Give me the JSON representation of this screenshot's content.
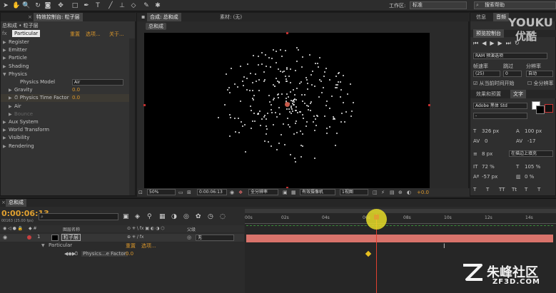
{
  "app": {
    "workspace_label": "工作区:",
    "workspace_value": "标准",
    "search_placeholder": "搜索帮助"
  },
  "left_panel": {
    "tab_close": "×",
    "tab_label": "特效控制台: 粒子层",
    "breadcrumb": "总和成 • 粒子层",
    "effect_name": "Particular",
    "reset_label": "重置",
    "options_label": "选项...",
    "about_label": "关于...",
    "properties": [
      {
        "label": "Register",
        "indent": 0,
        "value": ""
      },
      {
        "label": "Emitter",
        "indent": 0,
        "value": ""
      },
      {
        "label": "Particle",
        "indent": 0,
        "value": ""
      },
      {
        "label": "Shading",
        "indent": 0,
        "value": ""
      },
      {
        "label": "Physics",
        "indent": 0,
        "value": "",
        "open": true
      },
      {
        "label": "Physics Model",
        "indent": 2,
        "value": "Air",
        "dropdown": true
      },
      {
        "label": "Gravity",
        "indent": 1,
        "value": "0.0"
      },
      {
        "label": "Physics Time Factor",
        "indent": 1,
        "value": "0.0",
        "stopwatch": true
      },
      {
        "label": "Air",
        "indent": 1,
        "value": ""
      },
      {
        "label": "Bounce",
        "indent": 1,
        "value": "",
        "disabled": true
      },
      {
        "label": "Aux System",
        "indent": 0,
        "value": ""
      },
      {
        "label": "World Transform",
        "indent": 0,
        "value": ""
      },
      {
        "label": "Visibility",
        "indent": 0,
        "value": ""
      },
      {
        "label": "Rendering",
        "indent": 0,
        "value": ""
      }
    ]
  },
  "viewer": {
    "tab_label": "合成: 总和成",
    "footage_tab": "素材: (无)",
    "comp_chip": "总和成",
    "zoom": "50%",
    "timecode": "0:00:06:13",
    "resolution": "全分辨率",
    "camera": "有效摄像机",
    "view": "1视图",
    "exposure": "+0.0"
  },
  "right_panel": {
    "tab_info": "信息",
    "tab_audio": "音频",
    "preview_title": "预览控制台",
    "ram_preview": "RAM 预演选项",
    "frame_rate_label": "帧速率",
    "skip_label": "跳过",
    "resolution_label": "分辨率",
    "frame_rate_value": "(25)",
    "skip_value": "0",
    "resolution_value": "自动",
    "from_current": "从当前时间开始",
    "full_screen": "全分辨率",
    "effects_tab": "效果和预置",
    "char_tab": "文字",
    "font_name": "Adobe 黑体 Std",
    "font_style": "-",
    "font_size": "326 px",
    "leading": "100 px",
    "kerning": "0",
    "tracking": "-17",
    "stroke_width": "8 px",
    "stroke_mode": "在描边上填充",
    "v_scale": "72 %",
    "h_scale": "105 %",
    "baseline": "-57 px",
    "tsume": "0 %",
    "text_buttons": [
      "T",
      "T",
      "TT",
      "Tt",
      "T",
      "T"
    ]
  },
  "timeline": {
    "tab_label": "总和成",
    "timecode": "0:00:06:13",
    "frame_info": "00163 (25.00 fps)",
    "search_placeholder": "",
    "col_source": "图层名称",
    "col_parent": "父级",
    "ruler_labels": [
      "00s",
      "02s",
      "04s",
      "06s",
      "08s",
      "10s",
      "12s",
      "14s"
    ],
    "layer_number": "1",
    "layer_name": "粒子层",
    "parent_value": "无",
    "effect_name": "Particular",
    "reset_label": "重置",
    "options_label": "选项...",
    "prop_name": "Physics...e Factor",
    "prop_value": "0.0",
    "cursor_glyph": "I"
  },
  "watermarks": {
    "youku_line1": "YOUKU",
    "youku_line2": "优酷",
    "zf_name": "朱峰社区",
    "zf_domain": "ZF3D.COM"
  },
  "colors": {
    "accent_orange": "#d9962b",
    "layer_bar": "#d9736b",
    "playhead": "#e04030"
  }
}
